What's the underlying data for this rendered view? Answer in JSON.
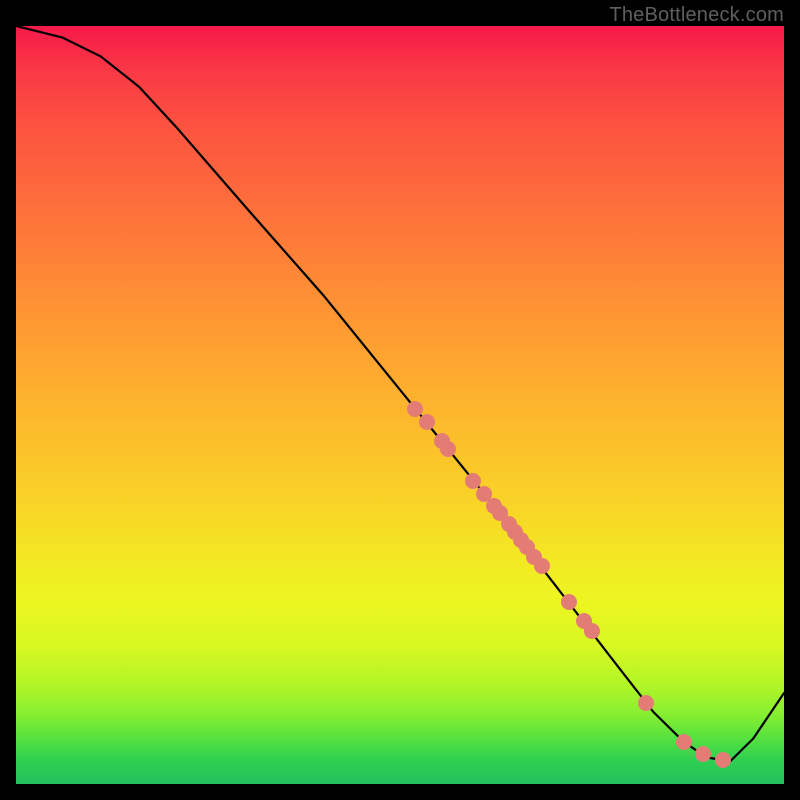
{
  "watermark": "TheBottleneck.com",
  "colors": {
    "dot": "#e47c76",
    "curve": "#000000",
    "frame": "#000000"
  },
  "chart_data": {
    "type": "line",
    "title": "",
    "xlabel": "",
    "ylabel": "",
    "xlim": [
      0,
      1
    ],
    "ylim": [
      0,
      1
    ],
    "curve": [
      {
        "x": 0.0,
        "y": 1.0
      },
      {
        "x": 0.06,
        "y": 0.985
      },
      {
        "x": 0.11,
        "y": 0.96
      },
      {
        "x": 0.16,
        "y": 0.92
      },
      {
        "x": 0.21,
        "y": 0.865
      },
      {
        "x": 0.3,
        "y": 0.76
      },
      {
        "x": 0.4,
        "y": 0.645
      },
      {
        "x": 0.5,
        "y": 0.52
      },
      {
        "x": 0.6,
        "y": 0.395
      },
      {
        "x": 0.7,
        "y": 0.265
      },
      {
        "x": 0.78,
        "y": 0.16
      },
      {
        "x": 0.83,
        "y": 0.095
      },
      {
        "x": 0.87,
        "y": 0.055
      },
      {
        "x": 0.9,
        "y": 0.035
      },
      {
        "x": 0.93,
        "y": 0.03
      },
      {
        "x": 0.96,
        "y": 0.06
      },
      {
        "x": 1.0,
        "y": 0.12
      }
    ],
    "points": [
      {
        "x": 0.52,
        "y": 0.495
      },
      {
        "x": 0.535,
        "y": 0.477
      },
      {
        "x": 0.555,
        "y": 0.452
      },
      {
        "x": 0.563,
        "y": 0.442
      },
      {
        "x": 0.595,
        "y": 0.4
      },
      {
        "x": 0.61,
        "y": 0.382
      },
      {
        "x": 0.622,
        "y": 0.367
      },
      {
        "x": 0.63,
        "y": 0.357
      },
      {
        "x": 0.642,
        "y": 0.343
      },
      {
        "x": 0.65,
        "y": 0.333
      },
      {
        "x": 0.658,
        "y": 0.322
      },
      {
        "x": 0.665,
        "y": 0.313
      },
      {
        "x": 0.675,
        "y": 0.3
      },
      {
        "x": 0.685,
        "y": 0.287
      },
      {
        "x": 0.72,
        "y": 0.24
      },
      {
        "x": 0.74,
        "y": 0.215
      },
      {
        "x": 0.75,
        "y": 0.202
      },
      {
        "x": 0.82,
        "y": 0.107
      },
      {
        "x": 0.87,
        "y": 0.055
      },
      {
        "x": 0.895,
        "y": 0.04
      },
      {
        "x": 0.92,
        "y": 0.032
      }
    ]
  }
}
